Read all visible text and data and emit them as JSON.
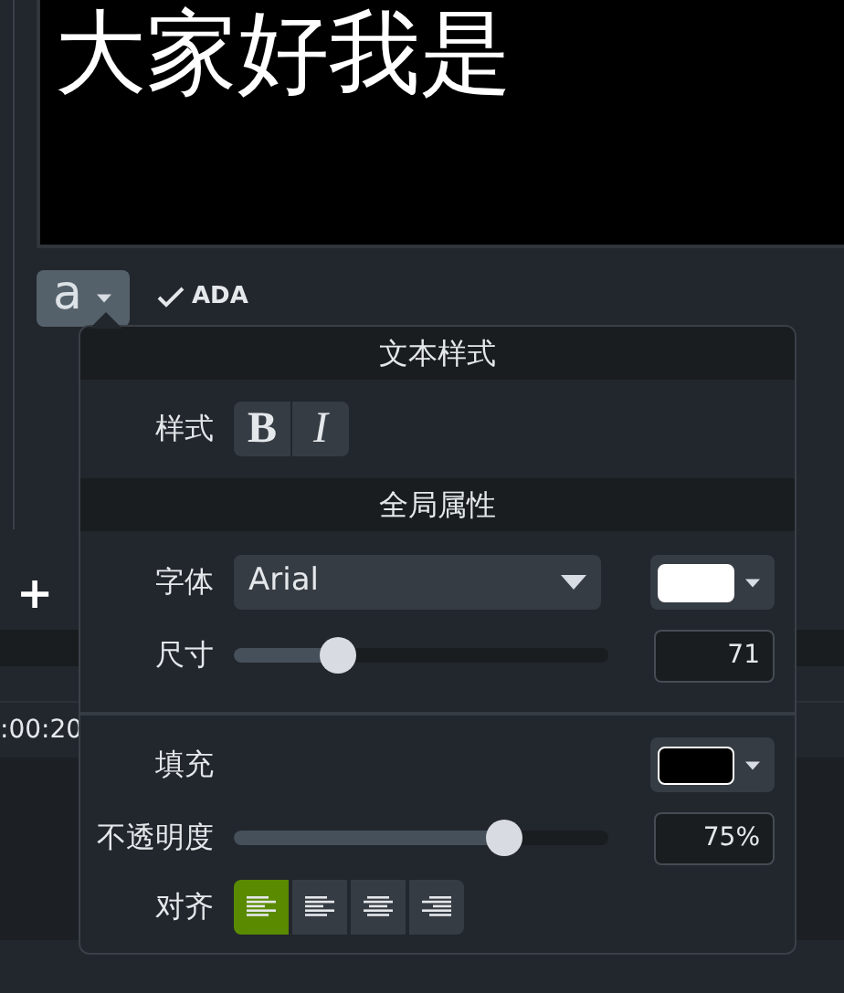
{
  "preview": {
    "caption": "大家好我是"
  },
  "toolbar": {
    "style_button": {
      "label": "a",
      "expanded": true
    },
    "ada": {
      "label": "ADA",
      "checked": true
    }
  },
  "timeline": {
    "add_label": "+",
    "timecode": ":00:20"
  },
  "popup": {
    "sections": [
      {
        "title": "文本样式",
        "rows": [
          {
            "kind": "style",
            "label": "样式",
            "buttons": [
              {
                "label": "B",
                "kind": "bold",
                "selected": false
              },
              {
                "label": "I",
                "kind": "italic",
                "selected": false
              }
            ]
          }
        ]
      },
      {
        "title": "全局属性",
        "rows": [
          {
            "kind": "font",
            "label": "字体",
            "value": "Arial",
            "color": "#ffffff"
          },
          {
            "kind": "slider",
            "label": "尺寸",
            "level": 0.28,
            "value": "71"
          },
          {
            "kind": "fill",
            "label": "填充",
            "color": "#000000"
          },
          {
            "kind": "slider",
            "label": "不透明度",
            "level": 0.72,
            "value": "75%"
          },
          {
            "kind": "align",
            "label": "对齐",
            "options": [
              {
                "kind": "left",
                "selected": true
              },
              {
                "kind": "left",
                "selected": false
              },
              {
                "kind": "center",
                "selected": false
              },
              {
                "kind": "right",
                "selected": false
              }
            ]
          }
        ]
      }
    ]
  }
}
